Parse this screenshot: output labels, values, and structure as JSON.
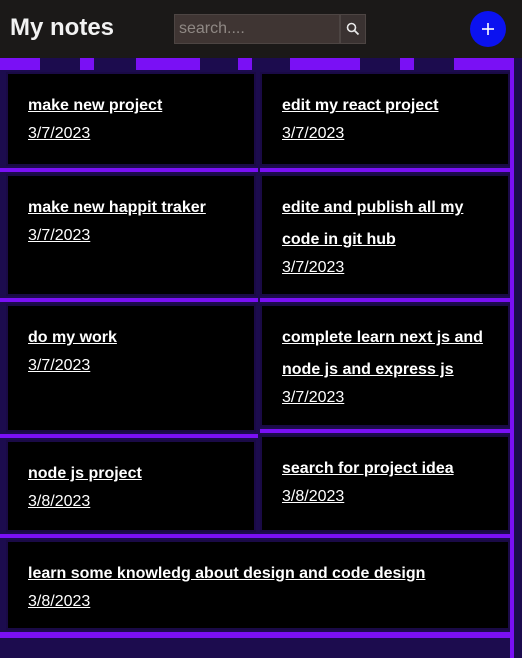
{
  "header": {
    "title": "My notes",
    "search_placeholder": "search....",
    "search_icon": "search-icon",
    "add_icon": "plus-icon",
    "add_label": "+"
  },
  "colors": {
    "accent": "#7a10f5",
    "add_button": "#0b12f0",
    "header_bg": "#1b1918"
  },
  "notes": [
    {
      "title": "make new project",
      "date": "3/7/2023"
    },
    {
      "title": "edit my react project",
      "date": "3/7/2023"
    },
    {
      "title": "make new happit traker",
      "date": "3/7/2023"
    },
    {
      "title": "edite and publish all my code in git hub",
      "date": "3/7/2023"
    },
    {
      "title": "do my work",
      "date": "3/7/2023"
    },
    {
      "title": "complete learn next js and node js and express js",
      "date": "3/7/2023"
    },
    {
      "title": "node js project",
      "date": "3/8/2023"
    },
    {
      "title": "search for project idea",
      "date": "3/8/2023"
    },
    {
      "title": "learn some knowledg about design and code design",
      "date": "3/8/2023"
    }
  ]
}
